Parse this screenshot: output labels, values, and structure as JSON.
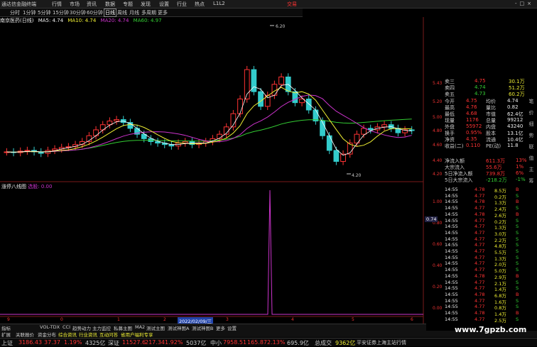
{
  "menubar": {
    "app_title": "通达信金融终端",
    "items": [
      "行情",
      "市场",
      "资讯",
      "数据",
      "专题",
      "发现",
      "设置",
      "行业",
      "热点",
      "L1L2"
    ],
    "trade_label": "交易",
    "window_controls": "-□×"
  },
  "periodbar": {
    "items": [
      "分时",
      "1分钟",
      "5分钟",
      "15分钟",
      "30分钟",
      "60分钟",
      "日线",
      "周线",
      "月线",
      "多周期",
      "更多"
    ],
    "active_index": 6
  },
  "ma_legend": {
    "stock": "南京医药(日线)",
    "ma5": "MA5: 4.74",
    "ma10": "MA10: 4.74",
    "ma20": "MA20: 4.74",
    "ma60": "MA60: 4.97"
  },
  "price_annotations": {
    "high": "6.20",
    "low": "4.20"
  },
  "price_axis": [
    "5.43",
    "5.20",
    "5.00",
    "4.80",
    "4.60",
    "4.40",
    "4.20"
  ],
  "indicator": {
    "legend": "涨停八线图",
    "legend_value": "选股: 0.00",
    "axis": [
      "1.00",
      "0.80",
      "0.60",
      "0.40",
      "0.20",
      "0.00"
    ]
  },
  "date_axis": {
    "cursor_date": "2022/02/09/三",
    "month_marks": [
      "9",
      "0",
      "1",
      "2",
      "3",
      "4",
      "5",
      "6"
    ]
  },
  "cursor_price": "0.74",
  "quote_panel": {
    "rows": [
      {
        "label": "卖三",
        "price": "4.75",
        "vol": "30.1万"
      },
      {
        "label": "卖四",
        "price": "4.74",
        "vol": "51.2万"
      },
      {
        "label": "卖五",
        "price": "4.73",
        "vol": "60.2万"
      }
    ],
    "stats": [
      {
        "l1": "今开",
        "v1": "4.75",
        "l2": "均价",
        "v2": "4.74"
      },
      {
        "l1": "最高",
        "v1": "4.76",
        "l2": "量比",
        "v2": "0.82"
      },
      {
        "l1": "最低",
        "v1": "4.68",
        "l2": "市值",
        "v2": "62.4亿"
      },
      {
        "l1": "现量",
        "v1": "1176",
        "l2": "总量",
        "v2": "99212"
      },
      {
        "l1": "外盘",
        "v1": "55972",
        "l2": "内盘",
        "v2": "43240"
      },
      {
        "l1": "换手",
        "v1": "0.95%",
        "l2": "股本",
        "v2": "13.1亿"
      },
      {
        "l1": "净资",
        "v1": "4.35",
        "l2": "流通",
        "v2": "10.4亿"
      },
      {
        "l1": "收益(二)",
        "v1": "0.110",
        "l2": "PE(动)",
        "v2": "11.8"
      }
    ],
    "flows": [
      {
        "label": "净流入额",
        "value": "611.3万",
        "pct": "13%",
        "color": "red"
      },
      {
        "label": "大宗流入",
        "value": "55.6万",
        "pct": "1%",
        "color": "red"
      },
      {
        "label": "5日净流入额",
        "value": "739.8万",
        "pct": "6%",
        "color": "red"
      },
      {
        "label": "5日大宗流入",
        "value": "-218.2万",
        "pct": "-1%",
        "color": "grn"
      }
    ]
  },
  "ticks": [
    {
      "time": "14:55",
      "price": "4.78",
      "vol": "8.5",
      "side": "B"
    },
    {
      "time": "14:55",
      "price": "4.77",
      "vol": "0.2",
      "side": "S"
    },
    {
      "time": "14:55",
      "price": "4.78",
      "vol": "1.3",
      "side": "B"
    },
    {
      "time": "14:55",
      "price": "4.77",
      "vol": "2.4",
      "side": "S"
    },
    {
      "time": "14:55",
      "price": "4.78",
      "vol": "2.6",
      "side": "B"
    },
    {
      "time": "14:55",
      "price": "4.77",
      "vol": "0.2",
      "side": "S"
    },
    {
      "time": "14:55",
      "price": "4.77",
      "vol": "1.3",
      "side": "S"
    },
    {
      "time": "14:55",
      "price": "4.77",
      "vol": "3.0",
      "side": "S"
    },
    {
      "time": "14:55",
      "price": "4.77",
      "vol": "2.2",
      "side": "S"
    },
    {
      "time": "14:55",
      "price": "4.77",
      "vol": "4.8",
      "side": "S"
    },
    {
      "time": "14:55",
      "price": "4.77",
      "vol": "5.5",
      "side": "S"
    },
    {
      "time": "14:55",
      "price": "4.77",
      "vol": "1.3",
      "side": "S"
    },
    {
      "time": "14:55",
      "price": "4.77",
      "vol": "2.0",
      "side": "S"
    },
    {
      "time": "14:55",
      "price": "4.77",
      "vol": "5.0",
      "side": "S"
    },
    {
      "time": "14:55",
      "price": "4.78",
      "vol": "2.9",
      "side": "B"
    },
    {
      "time": "14:55",
      "price": "4.77",
      "vol": "2.1",
      "side": "S"
    },
    {
      "time": "14:55",
      "price": "4.77",
      "vol": "1.4",
      "side": "S"
    },
    {
      "time": "14:55",
      "price": "4.78",
      "vol": "6.8",
      "side": "B"
    },
    {
      "time": "14:55",
      "price": "4.77",
      "vol": "1.6",
      "side": "S"
    },
    {
      "time": "14:55",
      "price": "4.77",
      "vol": "0.8",
      "side": "S"
    },
    {
      "time": "14:55",
      "price": "4.78",
      "vol": "1.4",
      "side": "B"
    },
    {
      "time": "14:55",
      "price": "4.77",
      "vol": "2.5",
      "side": "S"
    }
  ],
  "tick_unit": "万",
  "bottom_tabs": [
    "指标",
    "VOL-TDX",
    "CCI",
    "趋势动力",
    "主力监控",
    "私募主图",
    "MA2",
    "测试主图",
    "测试神图A",
    "测试神图B",
    "更多",
    "设置"
  ],
  "info_tabs": [
    "扩展",
    "关联报价",
    "资金分布",
    "综合资讯",
    "行业资讯",
    "互动问答",
    "省用户福利专享"
  ],
  "right_tabs": [
    "笔",
    "价",
    "细",
    "势",
    "联",
    "值",
    "主",
    "筹"
  ],
  "indices": [
    {
      "name": "上证",
      "value": "3186.43",
      "chg": "37.37",
      "pct": "1.19%",
      "amt": "4325亿"
    },
    {
      "name": "深证",
      "value": "11527.6",
      "chg": "217.34",
      "pct": "1.92%",
      "amt": "5037亿"
    },
    {
      "name": "中小",
      "value": "7958.51",
      "chg": "165.87",
      "pct": "2.13%",
      "amt": "695.9亿"
    },
    {
      "name": "总成交",
      "value": "9362亿",
      "chg": "",
      "pct": "",
      "amt": ""
    }
  ],
  "status_right": "平安证券上海主站行情",
  "watermark": "www.7gpzb.com",
  "colors": {
    "up": "#ff3333",
    "down": "#33cccc",
    "ma5": "#ffffff",
    "ma10": "#eeee33",
    "ma20": "#cc33cc",
    "ma60": "#33cc33"
  }
}
